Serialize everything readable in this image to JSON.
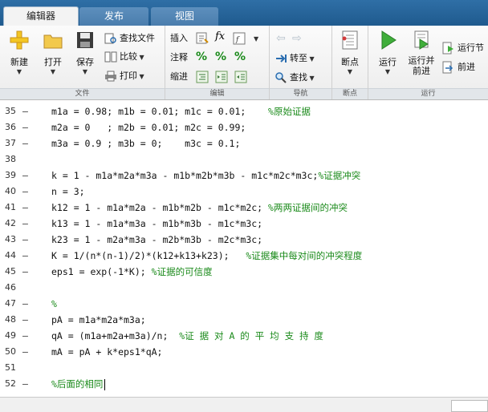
{
  "tabs": [
    {
      "label": "编辑器",
      "active": true
    },
    {
      "label": "发布",
      "active": false
    },
    {
      "label": "视图",
      "active": false
    }
  ],
  "ribbon": {
    "file": {
      "label": "文件",
      "new": "新建",
      "open": "打开",
      "save": "保存",
      "find_files": "查找文件",
      "compare": "比较",
      "print": "打印"
    },
    "edit": {
      "label": "编辑",
      "insert": "插入",
      "comment": "注释",
      "indent": "缩进"
    },
    "navigate": {
      "label": "导航",
      "goto": "转至",
      "find": "查找"
    },
    "breakpoints": {
      "label": "断点",
      "breakpoints": "断点"
    },
    "run": {
      "label": "运行",
      "run": "运行",
      "run_advance_l1": "运行并",
      "run_advance_l2": "前进",
      "run_section": "运行节",
      "advance": "前进"
    }
  },
  "code_lines": [
    {
      "num": "35",
      "code": "m1a = 0.98; m1b = 0.01; m1c = 0.01;",
      "comment": "%原始证据",
      "gap": "    "
    },
    {
      "num": "36",
      "code": "m2a = 0   ; m2b = 0.01; m2c = 0.99;",
      "comment": "",
      "gap": ""
    },
    {
      "num": "37",
      "code": "m3a = 0.9 ; m3b = 0;    m3c = 0.1;",
      "comment": "",
      "gap": ""
    },
    {
      "num": "38",
      "code": "",
      "comment": "",
      "gap": ""
    },
    {
      "num": "39",
      "code": "k = 1 - m1a*m2a*m3a - m1b*m2b*m3b - m1c*m2c*m3c;",
      "comment": "%证据冲突",
      "gap": ""
    },
    {
      "num": "40",
      "code": "n = 3;",
      "comment": "",
      "gap": ""
    },
    {
      "num": "41",
      "code": "k12 = 1 - m1a*m2a - m1b*m2b - m1c*m2c;",
      "comment": "%两两证据间的冲突",
      "gap": " "
    },
    {
      "num": "42",
      "code": "k13 = 1 - m1a*m3a - m1b*m3b - m1c*m3c;",
      "comment": "",
      "gap": ""
    },
    {
      "num": "43",
      "code": "k23 = 1 - m2a*m3a - m2b*m3b - m2c*m3c;",
      "comment": "",
      "gap": ""
    },
    {
      "num": "44",
      "code": "K = 1/(n*(n-1)/2)*(k12+k13+k23);",
      "comment": "%证据集中每对间的冲突程度",
      "gap": "   "
    },
    {
      "num": "45",
      "code": "eps1 = exp(-1*K);",
      "comment": "%证据的可信度",
      "gap": " "
    },
    {
      "num": "46",
      "code": "",
      "comment": "",
      "gap": ""
    },
    {
      "num": "47",
      "code": "",
      "comment": "%",
      "gap": ""
    },
    {
      "num": "48",
      "code": "pA = m1a*m2a*m3a;",
      "comment": "",
      "gap": ""
    },
    {
      "num": "49",
      "code": "qA = (m1a+m2a+m3a)/n;",
      "comment": "%证 据 对 A 的 平 均 支 持 度",
      "gap": "  "
    },
    {
      "num": "50",
      "code": "mA = pA + k*eps1*qA;",
      "comment": "",
      "gap": ""
    },
    {
      "num": "51",
      "code": "",
      "comment": "",
      "gap": ""
    },
    {
      "num": "52",
      "code": "",
      "comment": "%后面的相同",
      "gap": ""
    }
  ],
  "dash_glyph": "—"
}
